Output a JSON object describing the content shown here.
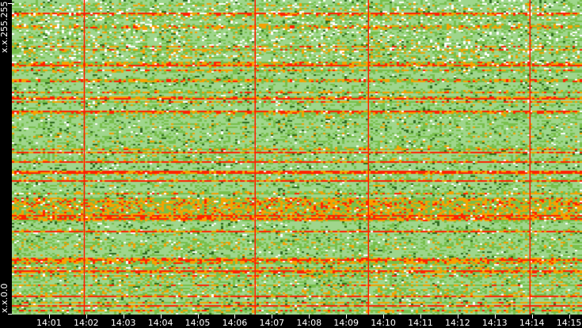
{
  "chart_data": {
    "type": "heatmap",
    "title": "",
    "xlabel": "",
    "ylabel": "",
    "x_tick_labels": [
      "14:01",
      "14:02",
      "14:03",
      "14:04",
      "14:05",
      "14:06",
      "14:07",
      "14:08",
      "14:09",
      "14:10",
      "14:11",
      "14:12",
      "14:13",
      "14:14",
      "14:15"
    ],
    "x_tick_minutes": [
      1,
      2,
      3,
      4,
      5,
      6,
      7,
      8,
      9,
      10,
      11,
      12,
      13,
      14,
      15
    ],
    "x_range_minutes": [
      0.0,
      15.35
    ],
    "y_labels": {
      "top": "x.x.255.255",
      "bottom": "x.x.0.0"
    },
    "rows": 199,
    "columns": 240,
    "highlight_times_minutes": [
      1.95,
      6.55,
      9.6,
      13.95
    ],
    "color_scale": [
      {
        "level": "none",
        "color": "#ffffff"
      },
      {
        "level": "very-low",
        "color": "#9fd68c"
      },
      {
        "level": "low",
        "color": "#78bf4a"
      },
      {
        "level": "low-dark",
        "color": "#2f6b1f"
      },
      {
        "level": "medium",
        "color": "#f5a200"
      },
      {
        "level": "high",
        "color": "#ff2200"
      }
    ],
    "highlight_color": "#ff2000",
    "seed": 73
  }
}
